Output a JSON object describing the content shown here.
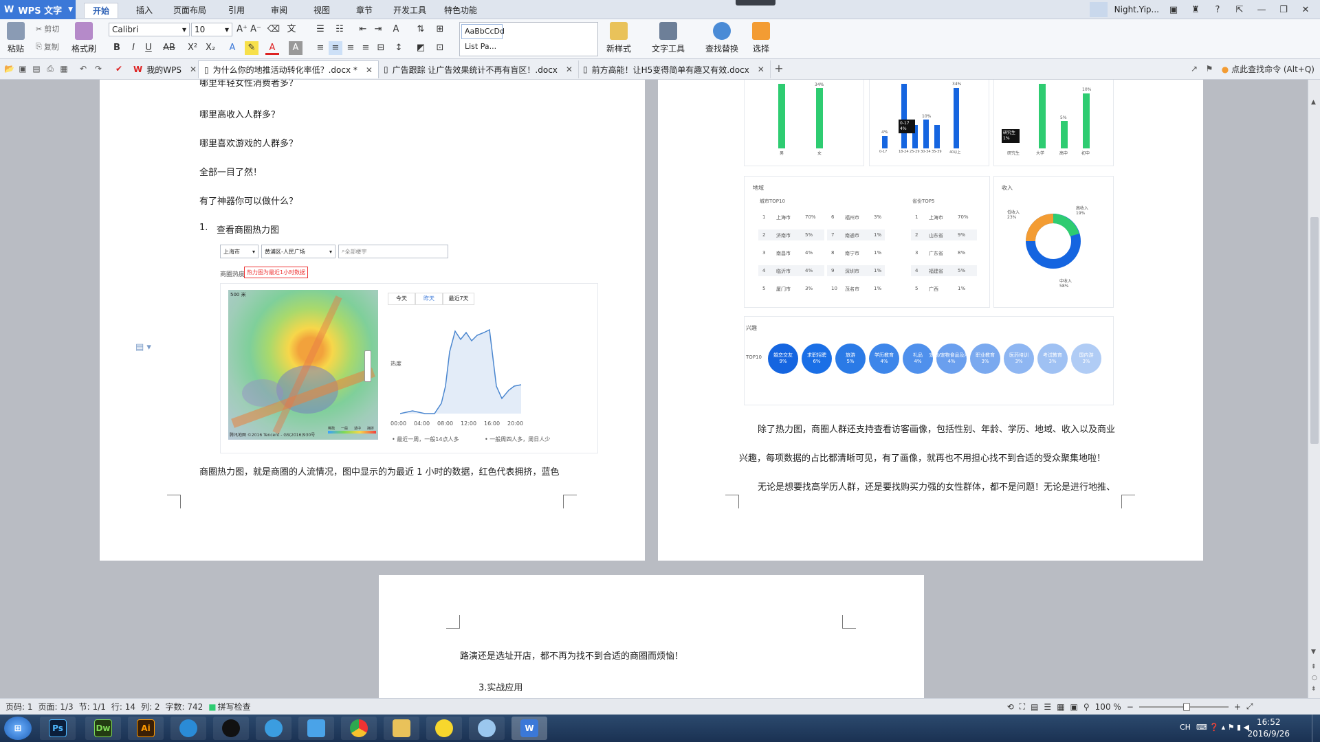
{
  "app": {
    "name": "WPS 文字"
  },
  "menu": {
    "tabs": [
      "开始",
      "插入",
      "页面布局",
      "引用",
      "审阅",
      "视图",
      "章节",
      "开发工具",
      "特色功能"
    ]
  },
  "user": {
    "name": "Night.Yip..."
  },
  "ribbon": {
    "paste": "粘贴",
    "cut": "剪切",
    "copy": "复制",
    "format_painter": "格式刷",
    "font": "Calibri",
    "size": "10",
    "style1": "AaBbCcDd",
    "style2": "List Pa...",
    "new_style": "新样式",
    "text_tool": "文字工具",
    "find_replace": "查找替换",
    "select": "选择"
  },
  "tabs": {
    "mywps": "我的WPS",
    "items": [
      "为什么你的地推活动转化率低？.docx *",
      "广告跟踪  让广告效果统计不再有盲区！.docx",
      "前方高能！让H5变得简单有趣又有效.docx"
    ],
    "cmd_search": "点此查找命令 (Alt+Q)"
  },
  "page1": {
    "lines": [
      "哪里年轻女性消费者多？",
      "哪里高收入人群多？",
      "哪里喜欢游戏的人群多？",
      "全部一目了然！",
      "有了神器你可以做什么？"
    ],
    "list_num": "1.",
    "list_item": "查看商圈热力图",
    "heatmap": {
      "city": "上海市",
      "district": "黄浦区-人民广场",
      "search_ph": "全部楼宇",
      "label": "商圈热度",
      "label_box": "热力图为最近1小时数据",
      "chart_tabs": [
        "今天",
        "昨天",
        "最近7天"
      ],
      "y_label": "热度",
      "x_ticks": [
        "00:00",
        "04:00",
        "08:00",
        "12:00",
        "16:00",
        "20:00"
      ],
      "legend": [
        "最近一周，一般14点人多",
        "一般周四人多，周日人少"
      ],
      "map_legend": [
        "稀疏",
        "一般",
        "适中",
        "拥挤"
      ],
      "map_scale": "500 米",
      "map_credit": "腾讯地图 ©2016 Tencent - GS(2016)930号"
    },
    "bottom_text": "商圈热力图，就是商圈的人流情况，图中显示的为最近 1 小时的数据，红色代表拥挤，蓝色"
  },
  "page2": {
    "gender": {
      "labels": [
        "男",
        "女"
      ],
      "value_labels": [
        "",
        "34%"
      ]
    },
    "age": {
      "labels": [
        "0-17",
        "18-24",
        "25-29",
        "30-34",
        "35-39",
        "40以上"
      ],
      "value_labels": [
        "4%",
        "",
        "",
        "10%",
        "",
        "34%"
      ],
      "tooltip": "0-17\n4%"
    },
    "edu": {
      "labels": [
        "研究生",
        "大学",
        "高中",
        "初中"
      ],
      "value_labels": [
        "",
        "",
        "5%",
        "10%"
      ],
      "tooltip": "研究生\n1%"
    },
    "region": {
      "title": "地域",
      "city_title": "城市TOP10",
      "cities": [
        [
          "1",
          "上海市",
          "70%"
        ],
        [
          "2",
          "济南市",
          "5%"
        ],
        [
          "3",
          "南昌市",
          "4%"
        ],
        [
          "4",
          "临沂市",
          "4%"
        ],
        [
          "5",
          "厦门市",
          "3%"
        ]
      ],
      "cities2": [
        [
          "6",
          "福州市",
          "3%"
        ],
        [
          "7",
          "南通市",
          "1%"
        ],
        [
          "8",
          "南宁市",
          "1%"
        ],
        [
          "9",
          "深圳市",
          "1%"
        ],
        [
          "10",
          "茂名市",
          "1%"
        ]
      ],
      "prov_title": "省份TOP5",
      "provinces": [
        [
          "1",
          "上海市",
          "70%"
        ],
        [
          "2",
          "山东省",
          "9%"
        ],
        [
          "3",
          "广东省",
          "8%"
        ],
        [
          "4",
          "福建省",
          "5%"
        ],
        [
          "5",
          "广西",
          "1%"
        ]
      ]
    },
    "income": {
      "title": "收入",
      "labels": [
        "低收入\n23%",
        "高收入\n19%",
        "中收入\n58%"
      ]
    },
    "interest": {
      "title": "兴趣",
      "row_label": "TOP10",
      "bubbles": [
        "婚恋交友\n9%",
        "求职招聘\n6%",
        "旅游\n5%",
        "学历教育\n4%",
        "礼品\n4%",
        "宠物/宠物食品及用品\n4%",
        "职业教育\n3%",
        "医药培训\n3%",
        "考试教育\n3%",
        "国内游\n3%"
      ]
    },
    "para1": [
      "除了热力图，商圈人群还支持查看访客画像，包括性别、年龄、学历、地域、收入以及商业",
      "兴趣，每项数据的占比都清晰可见，有了画像，就再也不用担心找不到合适的受众聚集地啦！"
    ],
    "para2": "无论是想要找高学历人群，还是要找购买力强的女性群体，都不是问题！无论是进行地推、"
  },
  "page3": {
    "line1": "路演还是选址开店，都不再为找不到合适的商圈而烦恼！",
    "line2": "3.实战应用"
  },
  "status": {
    "pagenum": "页码: 1",
    "pages": "页面: 1/3",
    "section": "节: 1/1",
    "row": "行: 14",
    "col": "列: 2",
    "words": "字数: 742",
    "spell": "拼写检查",
    "zoom": "100 %"
  },
  "taskbar": {
    "time": "16:52",
    "date": "2016/9/26",
    "lang": "CH",
    "apps": [
      "Ps",
      "Dw",
      "Ai"
    ]
  },
  "colors": {
    "accent": "#3b78d8",
    "green": "#2ecc71",
    "blue": "#1565e0"
  }
}
